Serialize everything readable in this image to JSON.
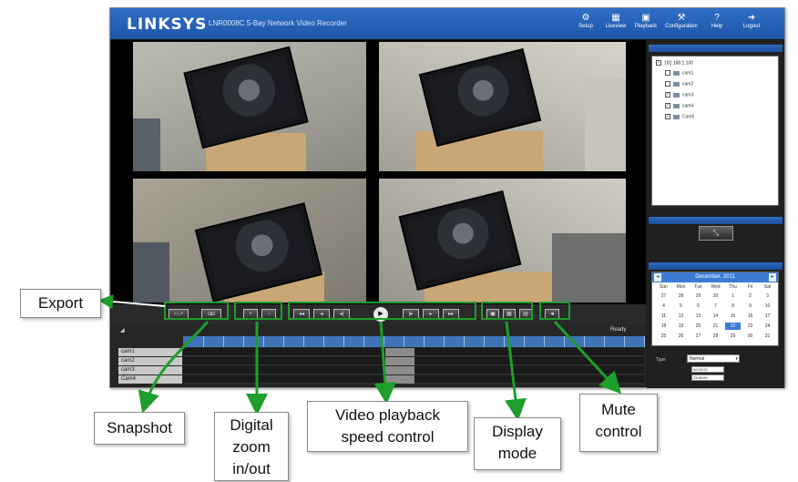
{
  "app": {
    "logo": "LINKSYS",
    "product_title": "LNR0008C 5-Bay Network Video Recorder"
  },
  "nav": [
    {
      "label": "Setup",
      "icon": "gear-icon"
    },
    {
      "label": "Liveview",
      "icon": "grid-icon"
    },
    {
      "label": "Playback",
      "icon": "playback-icon"
    },
    {
      "label": "Configuration",
      "icon": "config-icon"
    },
    {
      "label": "Help",
      "icon": "help-icon"
    },
    {
      "label": "Logout",
      "icon": "logout-icon"
    }
  ],
  "controls": {
    "export_label": "▭↗",
    "snapshot_label": "◘◘",
    "zoom_in_label": "+",
    "zoom_out_label": "−",
    "speed_labels": [
      "◂◂",
      "◂",
      "◂|"
    ],
    "speed_labels_right": [
      "|▸",
      "▸",
      "▸▸"
    ],
    "play_label": "▶",
    "display_labels": [
      "▣",
      "▦",
      "▤"
    ],
    "mute_label": "◄"
  },
  "timeline": {
    "left_label": "◢",
    "right_label": "Ready",
    "cameras": [
      "cam1",
      "cam2",
      "cam3",
      "Cam4"
    ]
  },
  "sidebar": {
    "tree_root": "192.168.1.100",
    "cameras": [
      {
        "name": "cam1",
        "checked": false
      },
      {
        "name": "cam2",
        "checked": false
      },
      {
        "name": "cam3",
        "checked": true
      },
      {
        "name": "cam4",
        "checked": true
      },
      {
        "name": "Cam5",
        "checked": true
      }
    ],
    "ptz_label": "⤡"
  },
  "calendar": {
    "title": "December, 2011",
    "prev": "◂",
    "next": "▸",
    "weekdays": [
      "Sun",
      "Mon",
      "Tue",
      "Wed",
      "Thu",
      "Fri",
      "Sat"
    ],
    "days": [
      "27",
      "28",
      "29",
      "30",
      "1",
      "2",
      "3",
      "4",
      "5",
      "6",
      "7",
      "8",
      "9",
      "10",
      "11",
      "12",
      "13",
      "14",
      "15",
      "16",
      "17",
      "18",
      "19",
      "20",
      "21",
      "22",
      "23",
      "24",
      "25",
      "26",
      "27",
      "28",
      "29",
      "30",
      "31"
    ],
    "selected": "22"
  },
  "filters": {
    "type_label": "Type",
    "type_value": "Normal",
    "time_from": "00:00:00",
    "time_to": "23:59:59"
  },
  "annotations": {
    "export": "Export",
    "snapshot": "Snapshot",
    "digital_zoom": "Digital zoom in/out",
    "playback_speed": "Video playback speed control",
    "display_mode": "Display mode",
    "mute": "Mute control"
  },
  "colors": {
    "header_blue": "#1e56a8",
    "timeline_blue": "#3f74b9",
    "highlight_green": "#1e9e2b"
  }
}
